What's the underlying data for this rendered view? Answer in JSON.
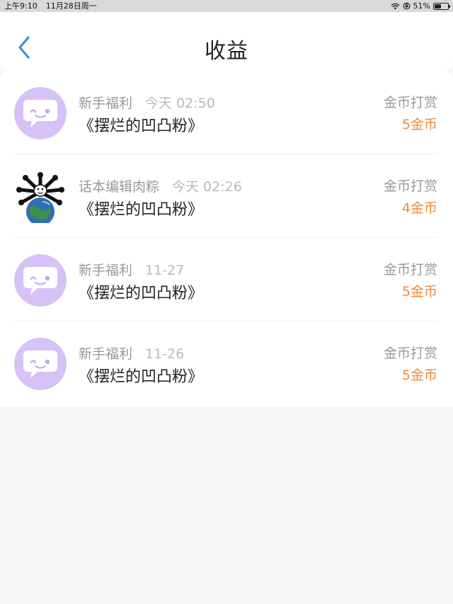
{
  "status_bar": {
    "time": "上午9:10",
    "date": "11月28日周一",
    "battery_percent": "51%",
    "battery_level": 0.51,
    "icons": [
      "wifi-icon",
      "orientation-lock-icon",
      "battery-icon"
    ]
  },
  "header": {
    "back_icon": "chevron-left-icon",
    "title": "收益"
  },
  "colors": {
    "accent_blue": "#3a8ee6",
    "reward_orange": "#f08a3c",
    "avatar_purple": "#d6c2f7",
    "text_primary": "#222222",
    "text_secondary": "#999999"
  },
  "records": [
    {
      "avatar": "bot",
      "sender": "新手福利",
      "time": "今天 02:50",
      "work": "《摆烂的凹凸粉》",
      "type": "金币打赏",
      "amount": "5金币"
    },
    {
      "avatar": "user",
      "sender": "话本编辑肉粽",
      "time": "今天 02:26",
      "work": "《摆烂的凹凸粉》",
      "type": "金币打赏",
      "amount": "4金币"
    },
    {
      "avatar": "bot",
      "sender": "新手福利",
      "time": "11-27",
      "work": "《摆烂的凹凸粉》",
      "type": "金币打赏",
      "amount": "5金币"
    },
    {
      "avatar": "bot",
      "sender": "新手福利",
      "time": "11-26",
      "work": "《摆烂的凹凸粉》",
      "type": "金币打赏",
      "amount": "5金币"
    }
  ]
}
